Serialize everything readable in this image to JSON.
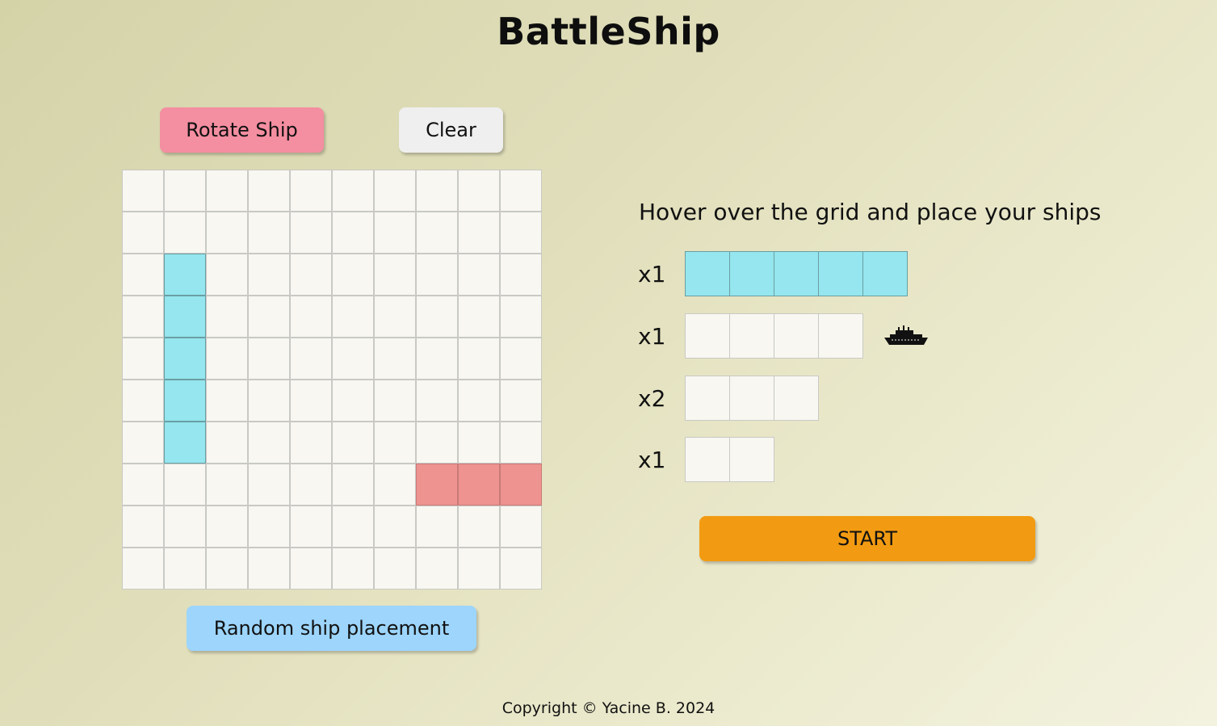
{
  "header": {
    "title": "BattleShip"
  },
  "controls": {
    "rotate_label": "Rotate Ship",
    "clear_label": "Clear",
    "random_label": "Random ship placement",
    "start_label": "START"
  },
  "board": {
    "rows": 10,
    "cols": 10,
    "placed_ship_cells": [
      [
        2,
        1
      ],
      [
        3,
        1
      ],
      [
        4,
        1
      ],
      [
        5,
        1
      ],
      [
        6,
        1
      ]
    ],
    "hover_preview_cells": [
      [
        7,
        7
      ],
      [
        7,
        8
      ],
      [
        7,
        9
      ]
    ]
  },
  "fleet": {
    "instruction": "Hover over the grid and place your ships",
    "ships": [
      {
        "count": "x1",
        "length": 5,
        "placed": true
      },
      {
        "count": "x1",
        "length": 4,
        "placed": false,
        "icon": "ship-icon"
      },
      {
        "count": "x2",
        "length": 3,
        "placed": false
      },
      {
        "count": "x1",
        "length": 2,
        "placed": false
      }
    ]
  },
  "colors": {
    "placed_ship": "#95e6ee",
    "hover_preview": "#ee9390",
    "rotate_button": "#f48ea1",
    "random_button": "#9dd5fc",
    "start_button": "#f29b12"
  },
  "footer": {
    "copyright": "Copyright © Yacine B. 2024"
  }
}
